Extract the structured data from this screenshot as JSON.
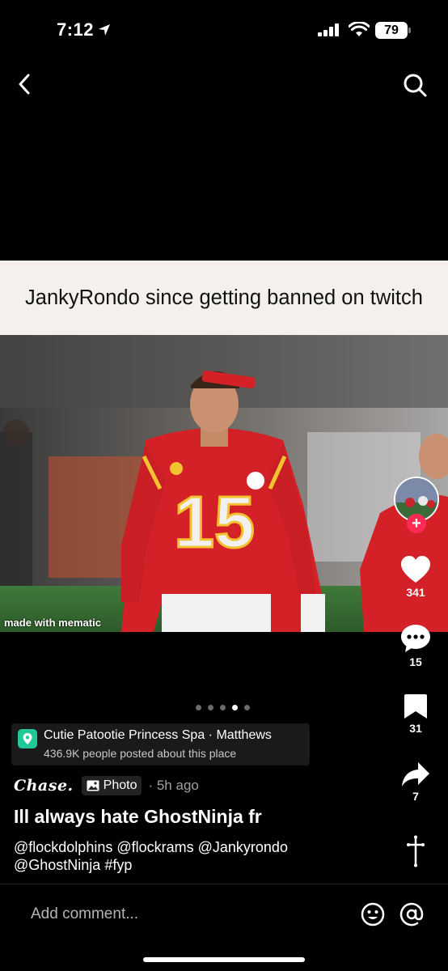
{
  "status_bar": {
    "time": "7:12",
    "battery": "79"
  },
  "meme": {
    "caption": "JankyRondo since getting banned on twitch",
    "jersey_number": "15",
    "watermark": "made with mematic"
  },
  "carousel": {
    "dots": 5,
    "active_index": 3
  },
  "actions": {
    "likes": "341",
    "comments": "15",
    "saves": "31",
    "shares": "7"
  },
  "location": {
    "name": "Cutie Patootie Princess Spa · Matthews",
    "subtitle": "436.9K people posted about this place"
  },
  "post": {
    "author": "Chase.",
    "type_label": "Photo",
    "time": "· 5h ago",
    "title": "Ill always hate GhostNinja fr",
    "tags": "@flockdolphins @flockrams @Jankyrondo @GhostNinja #fyp"
  },
  "comment_bar": {
    "placeholder": "Add comment..."
  },
  "colors": {
    "like_accent": "#fe2c55",
    "location_badge": "#20c997"
  }
}
